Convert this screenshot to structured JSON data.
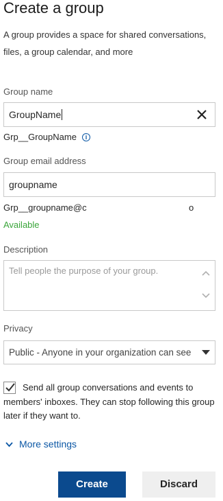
{
  "header": {
    "title": "Create a group",
    "intro": "A group provides a space for shared conversations, files, a group calendar, and more"
  },
  "group_name": {
    "label": "Group name",
    "value": "GroupName",
    "preview": "Grp__GroupName"
  },
  "group_email": {
    "label": "Group email address",
    "value": "groupname",
    "preview_prefix": "Grp__groupname@c",
    "preview_suffix": "o",
    "status": "Available",
    "status_color": "#3aa53a"
  },
  "description": {
    "label": "Description",
    "placeholder": "Tell people the purpose of your group."
  },
  "privacy": {
    "label": "Privacy",
    "selected": "Public - Anyone in your organization can see"
  },
  "subscribe": {
    "checked": true,
    "label": "Send all group conversations and events to members' inboxes. They can stop following this group later if they want to."
  },
  "more_settings": {
    "label": "More settings"
  },
  "actions": {
    "create_label": "Create",
    "discard_label": "Discard",
    "primary_color": "#0b4a8e"
  }
}
